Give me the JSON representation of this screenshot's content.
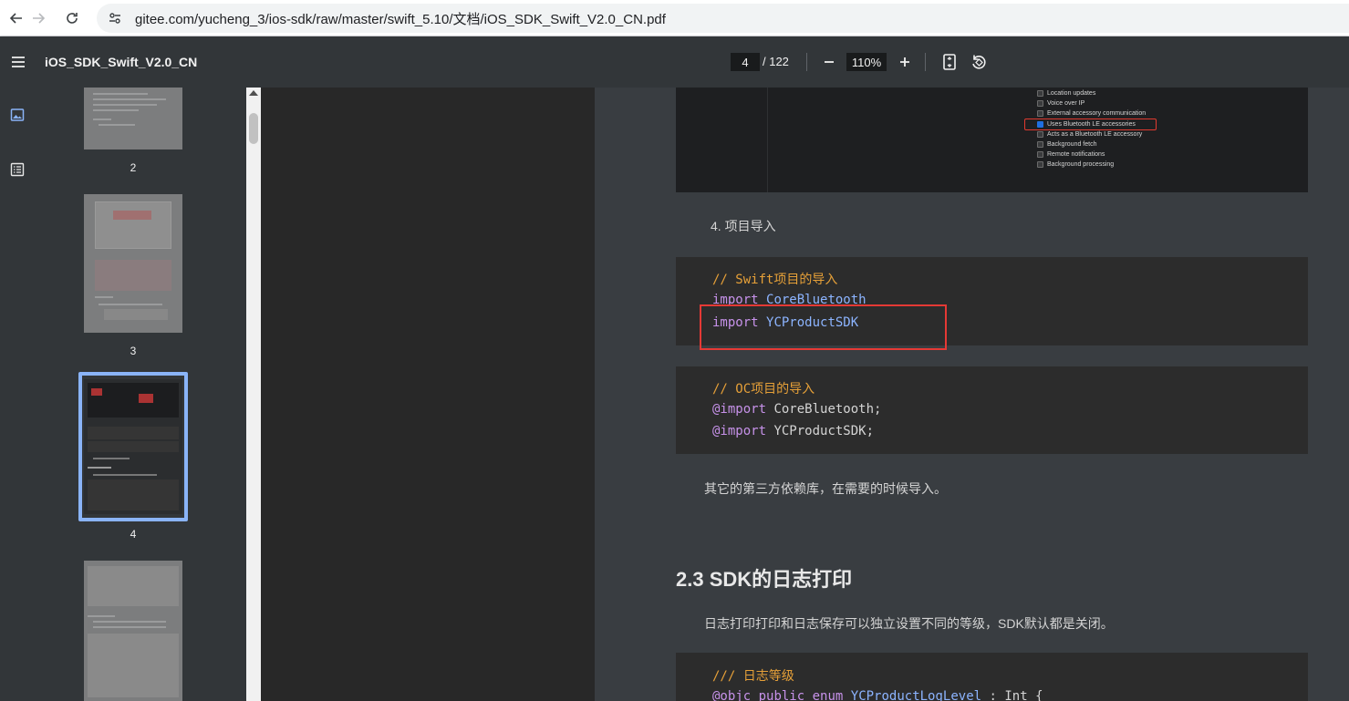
{
  "browser": {
    "url": "gitee.com/yucheng_3/ios-sdk/raw/master/swift_5.10/文档/iOS_SDK_Swift_V2.0_CN.pdf"
  },
  "toolbar": {
    "title": "iOS_SDK_Swift_V2.0_CN",
    "current_page": "4",
    "total_pages": "/ 122",
    "zoom": "110%",
    "zoom_out": "−",
    "zoom_in": "+"
  },
  "thumbnails": [
    {
      "label": "2"
    },
    {
      "label": "3"
    },
    {
      "label": "4"
    }
  ],
  "capabilities": [
    {
      "label": "Location updates",
      "checked": false
    },
    {
      "label": "Voice over IP",
      "checked": false
    },
    {
      "label": "External accessory communication",
      "checked": false
    },
    {
      "label": "Uses Bluetooth LE accessories",
      "checked": true
    },
    {
      "label": "Acts as a Bluetooth LE accessory",
      "checked": false
    },
    {
      "label": "Background fetch",
      "checked": false
    },
    {
      "label": "Remote notifications",
      "checked": false
    },
    {
      "label": "Background processing",
      "checked": false
    }
  ],
  "content": {
    "list_item": "4. 项目导入",
    "swift_block": {
      "comment": "// Swift项目的导入",
      "line1_kw": "import",
      "line1_mod": "CoreBluetooth",
      "line2_kw": "import",
      "line2_mod": "YCProductSDK"
    },
    "oc_block": {
      "comment": "// OC项目的导入",
      "line1_kw": "@import",
      "line1_mod": "CoreBluetooth;",
      "line2_kw": "@import",
      "line2_mod": "YCProductSDK;"
    },
    "para_other": "其它的第三方依赖库，在需要的时候导入。",
    "section_heading": "2.3 SDK的日志打印",
    "para_log": "日志打印打印和日志保存可以独立设置不同的等级，SDK默认都是关闭。",
    "log_block": {
      "comment": "/// 日志等级",
      "kw1": "@objc",
      "kw2": "public",
      "kw3": "enum",
      "type": "YCProductLogLevel",
      "rest": ": Int {"
    }
  },
  "colors": {
    "toolbar_bg": "#323639",
    "selection": "#8ab4f8",
    "highlight_red": "#e53935",
    "comment": "#e6a038",
    "keyword": "#c792ea",
    "type": "#8cb4ff"
  }
}
